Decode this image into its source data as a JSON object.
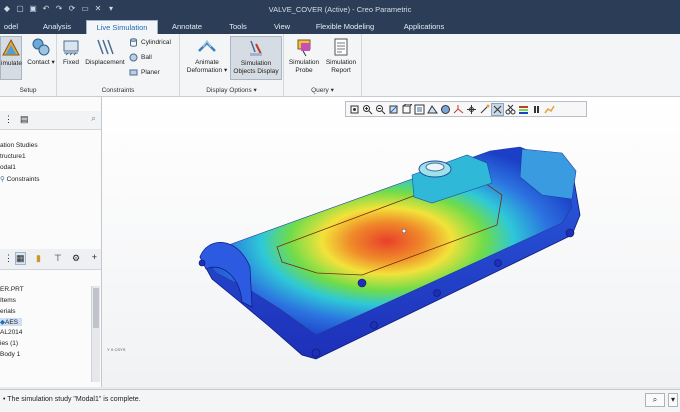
{
  "window": {
    "title": "VALVE_COVER (Active) - Creo Parametric"
  },
  "tabs": [
    "odel",
    "Analysis",
    "Live Simulation",
    "Annotate",
    "Tools",
    "View",
    "Flexible Modeling",
    "Applications"
  ],
  "ribbon": {
    "simulate_label": "imulate",
    "contact_label": "Contact",
    "setup_group": "Setup",
    "fixed_label": "Fixed",
    "displacement_label": "Displacement",
    "cylindrical_label": "Cylindrical",
    "ball_label": "Ball",
    "planer_label": "Planer",
    "constraints_group": "Constraints",
    "animate_label_1": "Animate",
    "animate_label_2": "Deformation",
    "simobj_label_1": "Simulation",
    "simobj_label_2": "Objects Display",
    "display_group": "Display Options",
    "probe_label_1": "Simulation",
    "probe_label_2": "Probe",
    "report_label_1": "Simulation",
    "report_label_2": "Report",
    "query_group": "Query"
  },
  "tree_top": [
    "ation Studies",
    "tructure1",
    "odal1",
    "Constraints"
  ],
  "tree_bottom": [
    "ER.PRT",
    "Items",
    "erials",
    "AES",
    "AL2014",
    "ies (1)",
    "Body 1"
  ],
  "status": {
    "message": "The simulation study \"Modal1\" is complete."
  },
  "icons": [
    "undo-icon",
    "redo-icon",
    "save-icon",
    "zoom-in-icon",
    "zoom-out-icon",
    "refit-icon",
    "search-icon",
    "filter-icon",
    "settings-icon",
    "add-icon",
    "pause-icon",
    "binoculars-icon"
  ],
  "colors": {
    "accent": "#1f6bb5",
    "titlebar": "#2c3e57",
    "selection": "#cfe0f4"
  }
}
